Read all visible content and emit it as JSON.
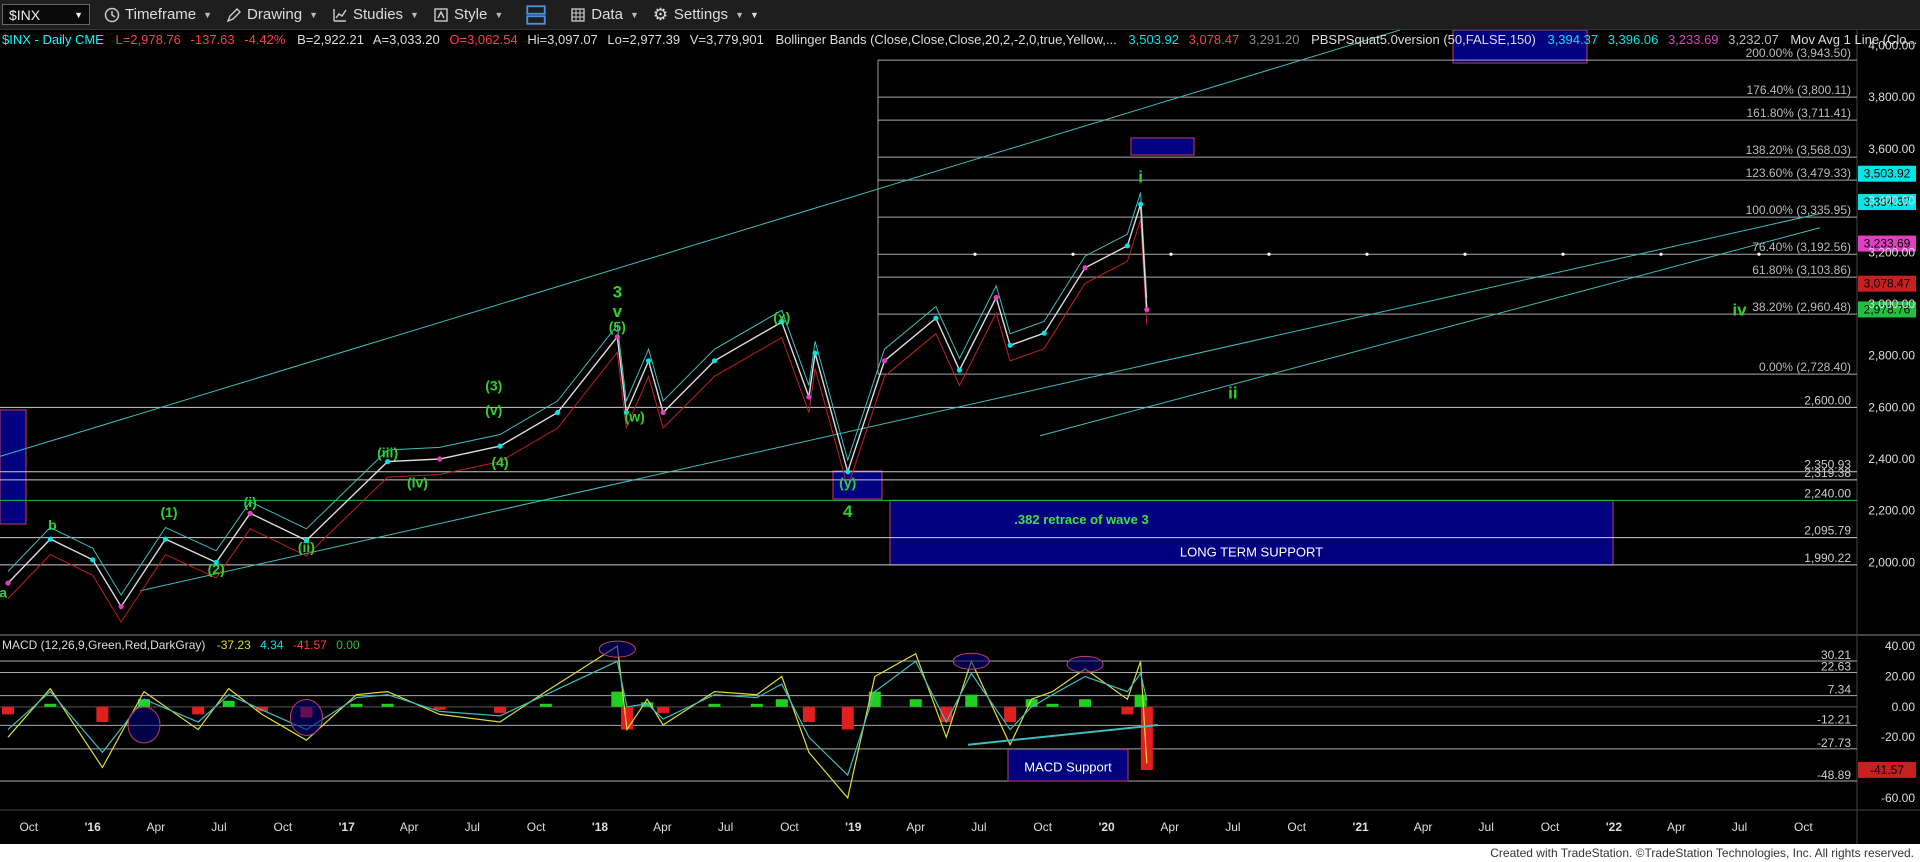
{
  "toolbar": {
    "symbol": "$INX",
    "timeframe": "Timeframe",
    "drawing": "Drawing",
    "studies": "Studies",
    "style": "Style",
    "data": "Data",
    "settings": "Settings"
  },
  "price_header": {
    "symbol": "$INX - Daily  CME",
    "last": "L=2,978.76",
    "change": "-137.63",
    "pct": "-4.42%",
    "bid": "B=2,922.21",
    "ask": "A=3,033.20",
    "open": "O=3,062.54",
    "high": "Hi=3,097.07",
    "low": "Lo=2,977.39",
    "volume": "V=3,779,901",
    "bb_label": "Bollinger Bands (Close,Close,Close,20,2,-2,0,true,Yellow,...",
    "bb_upper": "3,503.92",
    "bb_lower": "3,078.47",
    "bb_mid": "3,291.20",
    "pbs_label": "PBSPSquat5.0version (50,FALSE,150)",
    "pbs_1": "3,394.37",
    "pbs_2": "3,396.06",
    "pbs_3": "3,233.69",
    "pbs_4": "3,232.07",
    "ma_label": "Mov Avg 1 Line (Clo..."
  },
  "macd_header": {
    "label": "MACD (12,26,9,Green,Red,DarkGray)",
    "macd": "-37.23",
    "signal": "4.34",
    "hist": "-41.57",
    "zero": "0.00"
  },
  "chart_data": {
    "type": "line",
    "title": "$INX - Daily",
    "x_ticks": [
      "Oct",
      "'16",
      "Apr",
      "Jul",
      "Oct",
      "'17",
      "Apr",
      "Jul",
      "Oct",
      "'18",
      "Apr",
      "Jul",
      "Oct",
      "'19",
      "Apr",
      "Jul",
      "Oct",
      "'20",
      "Apr",
      "Jul",
      "Oct",
      "'21",
      "Apr",
      "Jul",
      "Oct",
      "'22",
      "Apr",
      "Jul",
      "Oct"
    ],
    "y_ticks": [
      2000,
      2200,
      2400,
      2600,
      2800,
      3000,
      3200,
      3400,
      3600,
      3800,
      4000
    ],
    "ylim": [
      1870,
      4060
    ],
    "price_series": {
      "name": "$INX",
      "x": [
        "2015-09-01",
        "2015-11-01",
        "2016-01-01",
        "2016-02-11",
        "2016-04-15",
        "2016-06-27",
        "2016-08-15",
        "2016-11-04",
        "2017-03-01",
        "2017-05-15",
        "2017-08-10",
        "2017-11-01",
        "2018-01-26",
        "2018-02-08",
        "2018-03-12",
        "2018-04-02",
        "2018-06-15",
        "2018-09-20",
        "2018-10-29",
        "2018-11-07",
        "2018-12-24",
        "2019-02-15",
        "2019-04-30",
        "2019-06-03",
        "2019-07-26",
        "2019-08-15",
        "2019-10-03",
        "2019-12-01",
        "2020-01-31",
        "2020-02-19",
        "2020-02-28"
      ],
      "y": [
        1920,
        2090,
        2010,
        1829,
        2090,
        2000,
        2190,
        2085,
        2390,
        2400,
        2450,
        2580,
        2873,
        2580,
        2780,
        2580,
        2780,
        2930,
        2640,
        2810,
        2351,
        2780,
        2945,
        2744,
        3025,
        2840,
        2887,
        3140,
        3225,
        3386,
        2978
      ]
    },
    "fib_levels": [
      {
        "label": "200.00% (3,943.50)",
        "value": 3943.5
      },
      {
        "label": "176.40% (3,800.11)",
        "value": 3800.11
      },
      {
        "label": "161.80% (3,711.41)",
        "value": 3711.41
      },
      {
        "label": "138.20% (3,568.03)",
        "value": 3568.03
      },
      {
        "label": "123.60% (3,479.33)",
        "value": 3479.33
      },
      {
        "label": "100.00% (3,335.95)",
        "value": 3335.95
      },
      {
        "label": "76.40% (3,192.56)",
        "value": 3192.56
      },
      {
        "label": "61.80% (3,103.86)",
        "value": 3103.86
      },
      {
        "label": "38.20% (2,960.48)",
        "value": 2960.48
      },
      {
        "label": "0.00% (2,728.40)",
        "value": 2728.4
      }
    ],
    "support_levels": [
      {
        "label": "2,600.00",
        "value": 2600
      },
      {
        "label": "2,350.93",
        "value": 2350.93
      },
      {
        "label": "2,319.38",
        "value": 2319.38
      },
      {
        "label": "2,240.00",
        "value": 2240
      },
      {
        "label": "2,095.79",
        "value": 2095.79
      },
      {
        "label": "1,990.22",
        "value": 1990.22
      }
    ],
    "price_tags": [
      {
        "label": "3,503.92",
        "value": 3503.92,
        "color": "#00e5e5"
      },
      {
        "label": "3,394.37",
        "value": 3394.37,
        "color": "#00e5e5"
      },
      {
        "label": "3,233.69",
        "value": 3233.69,
        "color": "#e040c0"
      },
      {
        "label": "3,078.47",
        "value": 3078.47,
        "color": "#c82020"
      },
      {
        "label": "2,978.76",
        "value": 2978.76,
        "color": "#20c040"
      }
    ],
    "wave_labels": [
      {
        "text": "a",
        "x": "2015-08-25",
        "y": 1865
      },
      {
        "text": "b",
        "x": "2015-11-04",
        "y": 2125
      },
      {
        "text": "(1)",
        "x": "2016-04-20",
        "y": 2175
      },
      {
        "text": "(2)",
        "x": "2016-06-27",
        "y": 1955
      },
      {
        "text": "(i)",
        "x": "2016-08-15",
        "y": 2215
      },
      {
        "text": "(ii)",
        "x": "2016-11-04",
        "y": 2040
      },
      {
        "text": "(iii)",
        "x": "2017-03-01",
        "y": 2405
      },
      {
        "text": "(iv)",
        "x": "2017-04-13",
        "y": 2290
      },
      {
        "text": "(4)",
        "x": "2017-08-10",
        "y": 2370
      },
      {
        "text": "(v)",
        "x": "2017-08-01",
        "y": 2570
      },
      {
        "text": "(3)",
        "x": "2017-08-01",
        "y": 2665
      },
      {
        "text": "(5)",
        "x": "2018-01-26",
        "y": 2893
      },
      {
        "text": "3",
        "x": "2018-01-26",
        "y": 3025
      },
      {
        "text": "v",
        "x": "2018-01-26",
        "y": 2950
      },
      {
        "text": "(w)",
        "x": "2018-02-20",
        "y": 2545
      },
      {
        "text": "(x)",
        "x": "2018-09-20",
        "y": 2930
      },
      {
        "text": "(y)",
        "x": "2018-12-24",
        "y": 2290
      },
      {
        "text": "4",
        "x": "2018-12-24",
        "y": 2175
      },
      {
        "text": "i",
        "x": "2020-02-19",
        "y": 3470
      },
      {
        "text": "ii",
        "x": "2020-07-01",
        "y": 2635
      },
      {
        "text": "iv",
        "x": "2022-07-01",
        "y": 2955
      }
    ],
    "boxes": [
      {
        "text": ".382 retrace of wave 3",
        "y_top": 2240,
        "y_bottom": 2095.79
      },
      {
        "text": "LONG TERM SUPPORT",
        "y_top": 2095.79,
        "y_bottom": 1990.22
      }
    ],
    "macd": {
      "y_ticks": [
        40,
        20,
        0,
        -20,
        -40,
        -60
      ],
      "ylim": [
        -66,
        46
      ],
      "levels": [
        {
          "label": "30.21",
          "value": 30.21
        },
        {
          "label": "22.63",
          "value": 22.63
        },
        {
          "label": "7.34",
          "value": 7.34
        },
        {
          "label": "-12.21",
          "value": -12.21
        },
        {
          "label": "-27.73",
          "value": -27.73
        },
        {
          "label": "-48.89",
          "value": -48.89
        }
      ],
      "current_tag": {
        "label": "-41.57",
        "value": -41.57
      },
      "support_box": "MACD Support",
      "x": [
        "2015-09-01",
        "2015-11-01",
        "2016-01-15",
        "2016-03-15",
        "2016-06-01",
        "2016-07-15",
        "2016-09-01",
        "2016-11-04",
        "2017-01-15",
        "2017-03-01",
        "2017-05-15",
        "2017-08-10",
        "2017-10-15",
        "2018-01-26",
        "2018-02-09",
        "2018-03-10",
        "2018-04-02",
        "2018-06-15",
        "2018-08-15",
        "2018-09-20",
        "2018-10-29",
        "2018-12-24",
        "2019-02-01",
        "2019-04-01",
        "2019-05-15",
        "2019-06-20",
        "2019-08-15",
        "2019-09-15",
        "2019-10-15",
        "2019-12-01",
        "2020-01-31",
        "2020-02-19",
        "2020-02-28"
      ],
      "macd_values": [
        -20,
        12,
        -40,
        10,
        -15,
        12,
        -5,
        -22,
        8,
        10,
        -5,
        -10,
        10,
        40,
        -15,
        5,
        -12,
        10,
        8,
        20,
        -30,
        -60,
        20,
        35,
        -20,
        30,
        -25,
        5,
        10,
        25,
        5,
        30,
        -37.23
      ],
      "signal_values": [
        -15,
        10,
        -30,
        5,
        -10,
        8,
        -2,
        -15,
        6,
        8,
        -3,
        -6,
        8,
        30,
        0,
        2,
        -8,
        8,
        6,
        15,
        -20,
        -45,
        10,
        30,
        -10,
        22,
        -15,
        0,
        8,
        20,
        10,
        22,
        4.34
      ]
    }
  }
}
